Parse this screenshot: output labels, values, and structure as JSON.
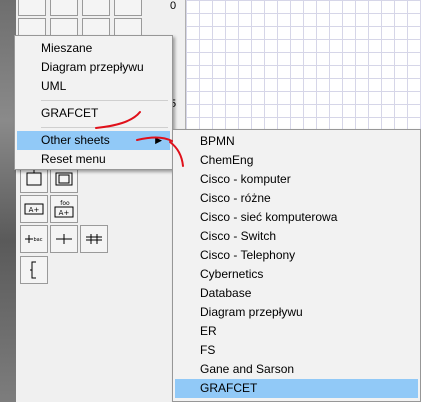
{
  "ruler": {
    "labels": [
      "0",
      "5"
    ]
  },
  "main_menu": {
    "items": [
      "Mieszane",
      "Diagram przepływu",
      "UML",
      "GRAFCET"
    ],
    "other_sheets": "Other sheets",
    "reset": "Reset menu",
    "highlighted": "Other sheets"
  },
  "sub_menu": {
    "items": [
      "BPMN",
      "ChemEng",
      "Cisco - komputer",
      "Cisco - różne",
      "Cisco - sieć komputerowa",
      "Cisco - Switch",
      "Cisco - Telephony",
      "Cybernetics",
      "Database",
      "Diagram przepływu",
      "ER",
      "FS",
      "Gane and Sarson",
      "GRAFCET"
    ],
    "highlighted": "GRAFCET"
  },
  "palette_labels": [
    "A+",
    "A+",
    "foo",
    "bac"
  ],
  "colors": {
    "highlight": "#91c9f7",
    "annotation": "#e0101a",
    "menu_bg": "#f2f2f2"
  }
}
